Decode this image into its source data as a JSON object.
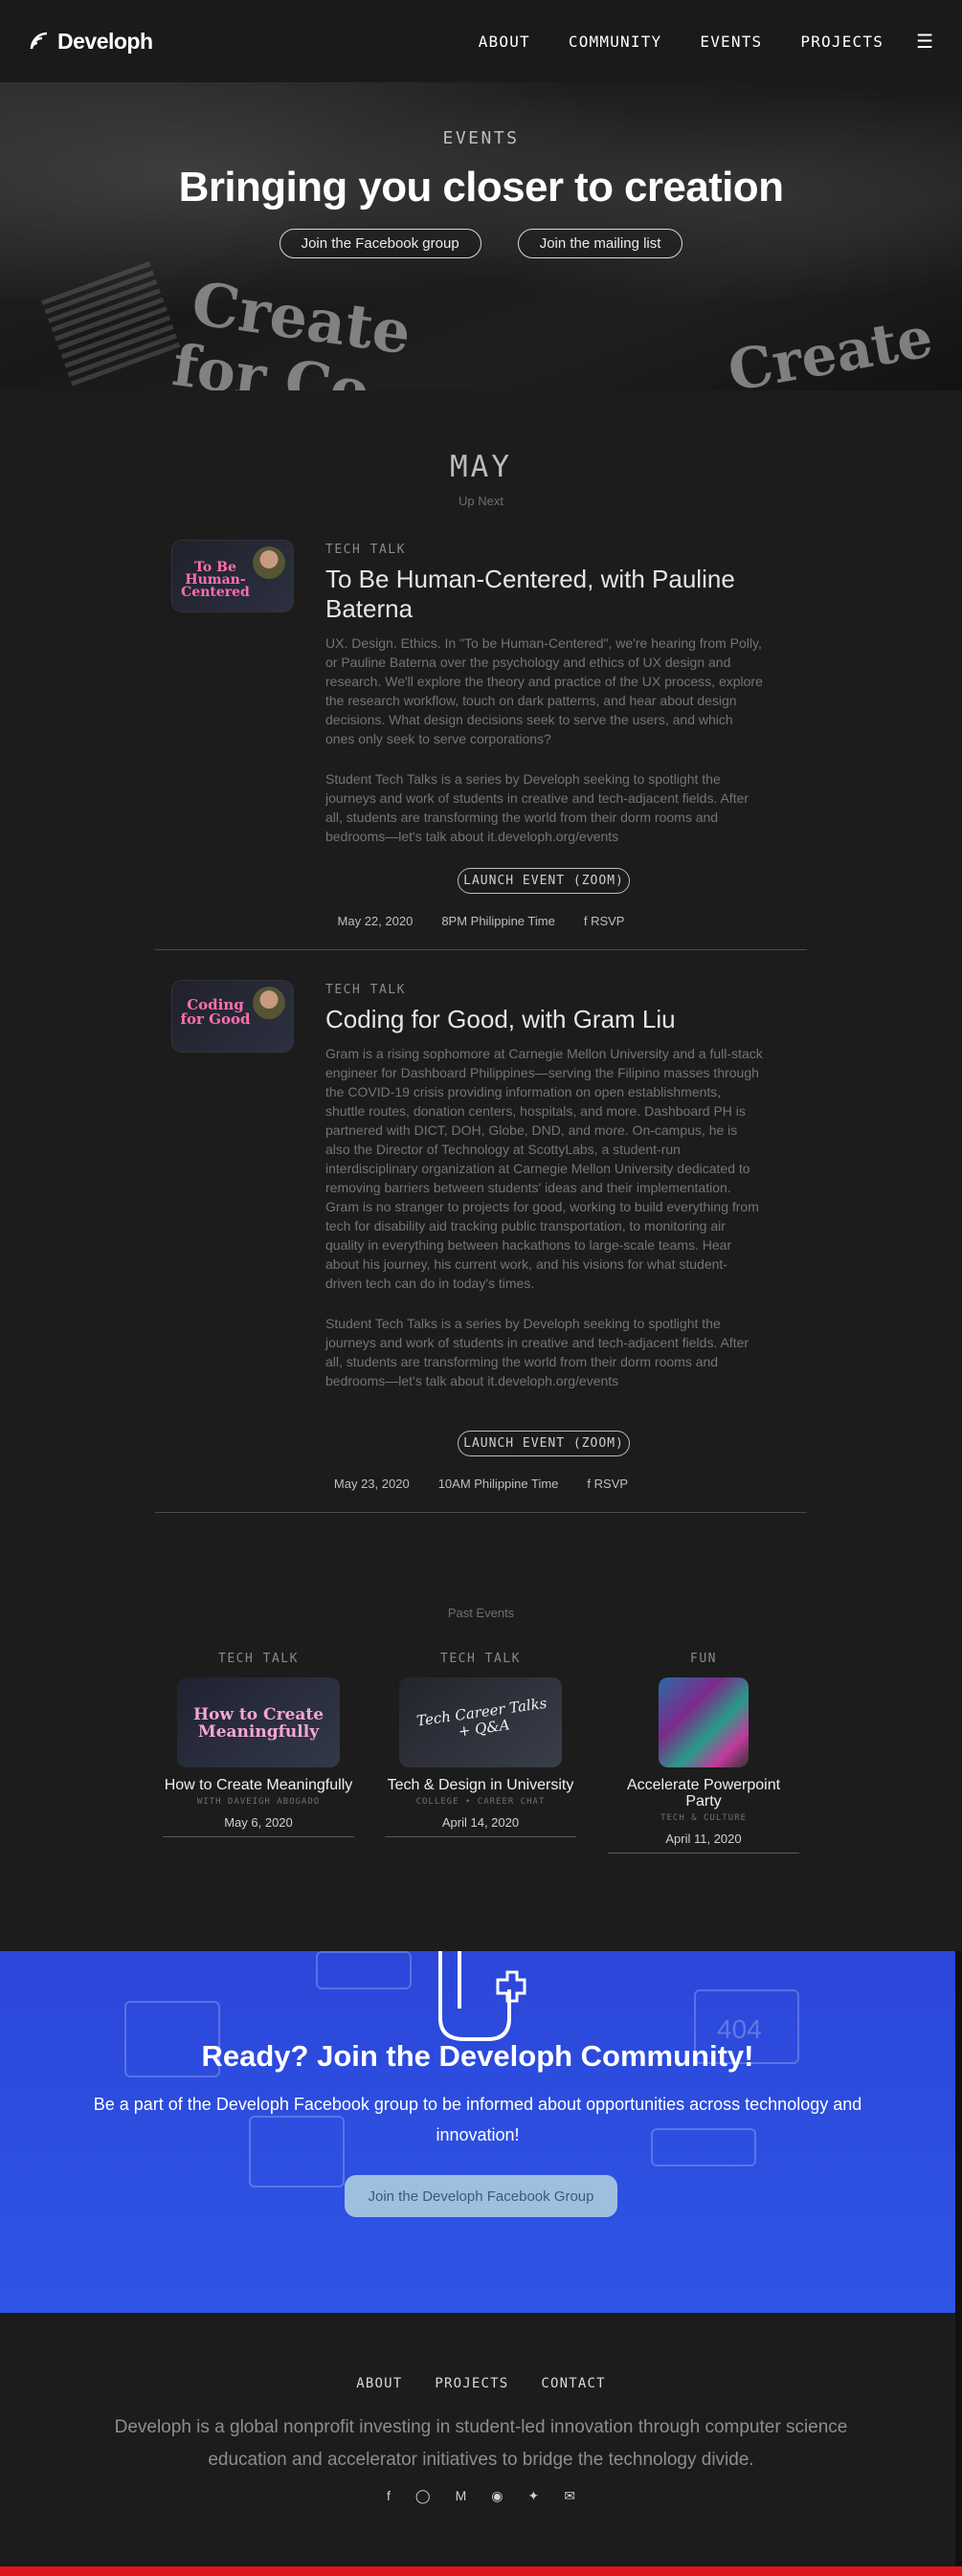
{
  "nav": {
    "brand": "Developh",
    "links": [
      "ABOUT",
      "COMMUNITY",
      "EVENTS",
      "PROJECTS"
    ],
    "menu_icon": "menu-icon"
  },
  "hero": {
    "eyebrow": "EVENTS",
    "title": "Bringing you closer to creation",
    "buttons": [
      "Join the Facebook group",
      "Join the mailing list"
    ],
    "shirt_text": [
      "Create",
      "for Co",
      "Create"
    ]
  },
  "upcoming": {
    "month": "MAY",
    "label": "Up Next",
    "events": [
      {
        "category": "TECH TALK",
        "title": "To Be Human-Centered, with Pauline Baterna",
        "thumb_text": "To Be Human-Centered",
        "description": "UX. Design. Ethics. In \"To be Human-Centered\", we're hearing from Polly, or Pauline Baterna over the psychology and ethics of UX design and research. We'll explore the theory and practice of the UX process, explore the research workflow, touch on dark patterns, and hear about design decisions. What design decisions seek to serve the users, and which ones only seek to serve corporations?",
        "series_note": "Student Tech Talks is a series by Developh seeking to spotlight the journeys and work of students in creative and tech-adjacent fields. After all, students are transforming the world from their dorm rooms and bedrooms—let's talk about it.developh.org/events",
        "button": "LAUNCH EVENT (ZOOM)",
        "date": "May 22, 2020",
        "time": "8PM Philippine Time",
        "rsvp": "RSVP"
      },
      {
        "category": "TECH TALK",
        "title": "Coding for Good, with Gram Liu",
        "thumb_text": "Coding for Good",
        "description": "Gram is a rising sophomore at Carnegie Mellon University and a full-stack engineer for Dashboard Philippines—serving the Filipino masses through the COVID-19 crisis providing information on open establishments, shuttle routes, donation centers, hospitals, and more. Dashboard PH is partnered with DICT, DOH, Globe, DND, and more. On-campus, he is also the Director of Technology at ScottyLabs, a student-run interdisciplinary organization at Carnegie Mellon University dedicated to removing barriers between students' ideas and their implementation. Gram is no stranger to projects for good, working to build everything from tech for disability aid tracking public transportation, to monitoring air quality in everything between hackathons to large-scale teams. Hear about his journey, his current work, and his visions for what student-driven tech can do in today's times.",
        "series_note": "Student Tech Talks is a series by Developh seeking to spotlight the journeys and work of students in creative and tech-adjacent fields. After all, students are transforming the world from their dorm rooms and bedrooms—let's talk about it.developh.org/events",
        "button": "LAUNCH EVENT (ZOOM)",
        "date": "May 23, 2020",
        "time": "10AM Philippine Time",
        "rsvp": "RSVP"
      }
    ]
  },
  "past": {
    "heading": "Past Events",
    "events": [
      {
        "category": "TECH TALK",
        "thumb_text": "How to Create Meaningfully",
        "title": "How to Create Meaningfully",
        "subtitle": "WITH DAVEIGH ABOGADO",
        "date": "May 6, 2020"
      },
      {
        "category": "TECH TALK",
        "thumb_text": "Tech Career Talks + Q&A",
        "title": "Tech & Design in University",
        "subtitle": "COLLEGE • CAREER CHAT",
        "date": "April 14, 2020"
      },
      {
        "category": "FUN",
        "thumb_text": "",
        "title": "Accelerate Powerpoint Party",
        "subtitle": "TECH & CULTURE",
        "date": "April 11, 2020"
      }
    ]
  },
  "cta": {
    "title": "Ready? Join the Developh Community!",
    "text": "Be a part of the Developh Facebook group to be informed about opportunities across technology and innovation!",
    "button": "Join the Developh Facebook Group",
    "deco_text": "404"
  },
  "footer": {
    "links": [
      "ABOUT",
      "PROJECTS",
      "CONTACT"
    ],
    "text": "Developh is a global nonprofit investing in student-led innovation through computer science education and accelerator initiatives to bridge the technology divide.",
    "socials": [
      "facebook-icon",
      "instagram-icon",
      "medium-icon",
      "github-icon",
      "twitter-icon",
      "email-icon"
    ]
  },
  "colors": {
    "background": "#1c1c1c",
    "cta_blue": "#2f55e6",
    "accent_red": "#e0141e"
  }
}
